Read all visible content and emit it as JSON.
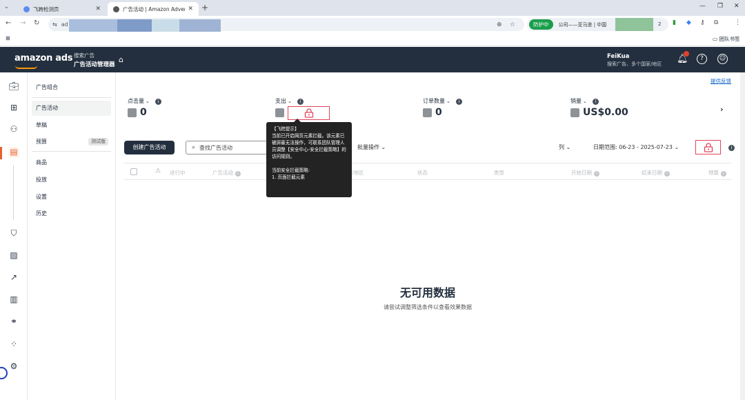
{
  "browser": {
    "tabs": [
      {
        "title": "飞跨检测页",
        "active": false
      },
      {
        "title": "广告活动 | Amazon Advertisin",
        "active": true
      }
    ],
    "url_prefix": "ad",
    "protect_label": "防护中",
    "ext_text": "公司——亚马逊 | 中国",
    "ext_count": "2",
    "bookmarks_folder": "团队书签"
  },
  "header": {
    "logo": "amazon ads",
    "subtitle": "搜索广告",
    "title": "广告活动管理器",
    "user_name": "FeiKua",
    "user_sub": "搜索广告、多个国家/地区"
  },
  "side_menu": {
    "items": [
      {
        "label": "广告组合"
      },
      {
        "label": "广告活动"
      },
      {
        "label": "草稿"
      },
      {
        "label": "预算",
        "badge": "测试版"
      },
      {
        "label": "商品"
      },
      {
        "label": "投放"
      },
      {
        "label": "设置"
      },
      {
        "label": "历史"
      }
    ]
  },
  "main": {
    "feedback": "提供反馈",
    "metrics": [
      {
        "label": "点击量",
        "value": "0"
      },
      {
        "label": "支出",
        "value": ""
      },
      {
        "label": "订单数量",
        "value": "0"
      },
      {
        "label": "销量",
        "value": "US$0.00"
      }
    ],
    "create_button": "创建广告活动",
    "search_placeholder": "查找广告活动",
    "bulk_actions": "批量操作",
    "columns": "列",
    "date_range": "日期范围: 06-23 - 2025-07-23",
    "table_headers": [
      "进行中",
      "广告活动",
      "/地区",
      "状态",
      "类型",
      "开始日期",
      "结束日期",
      "预算"
    ],
    "empty_title": "无可用数据",
    "empty_sub": "请尝试调整筛选条件以查看效果数据"
  },
  "tooltip": {
    "title": "【飞跨提示】",
    "body": "当前已开启网页元素拦截。该元素已被屏蔽无法操作，可联系团队管理人员调整【安全中心-安全拦截策略】的访问规则。",
    "policy_title": "当前安全拦截策略:",
    "policy_item": "1. 页面拦截元素"
  },
  "colors": {
    "header_bg": "#232f3e",
    "accent": "#e6612c",
    "lock_border": "#e0435a",
    "link": "#1667c7",
    "protect_green": "#1a9e4a"
  }
}
